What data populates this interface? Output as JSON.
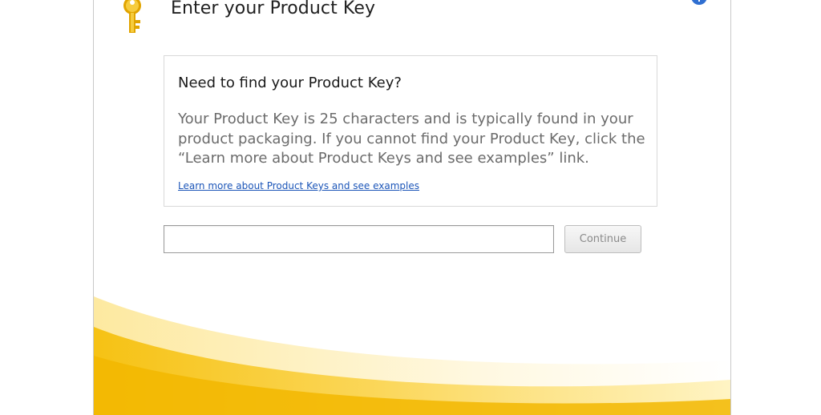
{
  "dialog": {
    "title": "Enter your Product Key",
    "icons": {
      "key": "key-icon",
      "help": "help-icon"
    }
  },
  "info": {
    "heading": "Need to find your Product Key?",
    "body": "Your Product Key is 25 characters and is typically found in your product packaging. If you cannot find your Product Key, click the “Learn more about Product Keys and see examples” link.",
    "link": "Learn more about Product Keys and see examples"
  },
  "form": {
    "product_key_value": "",
    "continue_label": "Continue"
  },
  "colors": {
    "accent_yellow": "#f7c41b",
    "link_blue": "#1b55b8",
    "help_blue": "#2f6fd1"
  }
}
